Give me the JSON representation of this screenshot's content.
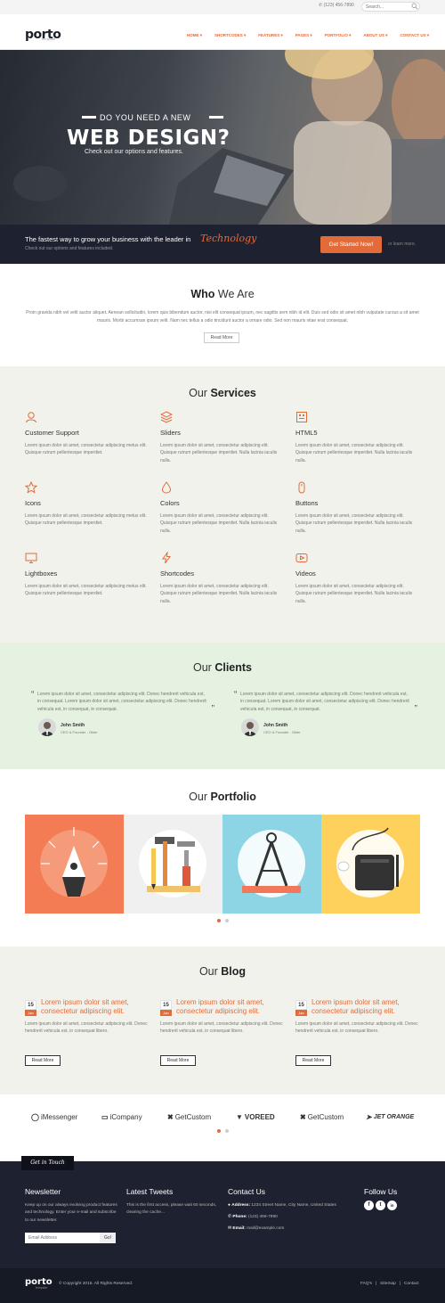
{
  "topbar": {
    "phone": "(123) 456-7890",
    "search_placeholder": "Search..."
  },
  "brand": {
    "name": "porto",
    "sub": "template"
  },
  "nav": {
    "items": [
      "HOME ▾",
      "SHORTCODES ▾",
      "FEATURES ▾",
      "PAGES ▾",
      "PORTFOLIO ▾",
      "ABOUT US ▾",
      "CONTACT US ▾"
    ]
  },
  "hero": {
    "kicker": "DO YOU NEED A NEW",
    "title": "WEB DESIGN?",
    "subtitle": "Check out our options and features."
  },
  "cta": {
    "text": "The fastest way to grow your business with the leader in",
    "highlight": "Technology",
    "sub": "Check out our options and features included.",
    "button": "Get Started Now!",
    "more": "or learn more."
  },
  "who": {
    "title_light": "Who",
    "title_rest": " We Are",
    "text": "Proin gravida nibh vel velit auctor aliquet. Aenean sollicitudin, lorem quis bibendum auctor, nisi elit consequat ipsum, nec sagittis sem nibh id elit. Duis sed odio sit amet nibh vulputate cursus a sit amet mauris. Morbi accumsan ipsum velit. Nam nec tellus a odio tincidunt auctor a ornare odio. Sed non mauris vitae erat consequat.",
    "button": "Read More"
  },
  "services": {
    "title_light": "Our ",
    "title_bold": "Services",
    "items": [
      {
        "icon": "user-icon",
        "title": "Customer Support",
        "desc": "Lorem ipsum dolor sit amet, consectetur adipiscing metus elit. Quisque rutrum pellentesque imperdiet."
      },
      {
        "icon": "layers-icon",
        "title": "Sliders",
        "desc": "Lorem ipsum dolor sit amet, consectetur adipiscing elit. Quisque rutrum pellentesque imperdiet. Nulla lacinia iaculis nulla."
      },
      {
        "icon": "html5-icon",
        "title": "HTML5",
        "desc": "Lorem ipsum dolor sit amet, consectetur adipiscing elit. Quisque rutrum pellentesque imperdiet. Nulla lacinia iaculis nulla."
      },
      {
        "icon": "star-icon",
        "title": "Icons",
        "desc": "Lorem ipsum dolor sit amet, consectetur adipiscing metus elit. Quisque rutrum pellentesque imperdiet."
      },
      {
        "icon": "drop-icon",
        "title": "Colors",
        "desc": "Lorem ipsum dolor sit amet, consectetur adipiscing elit. Quisque rutrum pellentesque imperdiet. Nulla lacinia iaculis nulla."
      },
      {
        "icon": "mouse-icon",
        "title": "Buttons",
        "desc": "Lorem ipsum dolor sit amet, consectetur adipiscing elit. Quisque rutrum pellentesque imperdiet. Nulla lacinia iaculis nulla."
      },
      {
        "icon": "monitor-icon",
        "title": "Lightboxes",
        "desc": "Lorem ipsum dolor sit amet, consectetur adipiscing metus elit. Quisque rutrum pellentesque imperdiet."
      },
      {
        "icon": "bolt-icon",
        "title": "Shortcodes",
        "desc": "Lorem ipsum dolor sit amet, consectetur adipiscing elit. Quisque rutrum pellentesque imperdiet. Nulla lacinia iaculis nulla."
      },
      {
        "icon": "play-icon",
        "title": "Videos",
        "desc": "Lorem ipsum dolor sit amet, consectetur adipiscing elit. Quisque rutrum pellentesque imperdiet. Nulla lacinia iaculis nulla."
      }
    ]
  },
  "clients": {
    "title_light": "Our ",
    "title_bold": "Clients",
    "testimonials": [
      {
        "quote": "Lorem ipsum dolor sit amet, consectetur adipiscing elit. Donec hendrerit vehicula est, in consequat. Lorem ipsum dolor sit amet, consectetur adipiscing elit. Donec hendrerit vehicula est, in consequat, in consequat.",
        "author": "John Smith",
        "role": "CEO & Founder - Okler"
      },
      {
        "quote": "Lorem ipsum dolor sit amet, consectetur adipiscing elit. Donec hendrerit vehicula est, in consequat. Lorem ipsum dolor sit amet, consectetur adipiscing elit. Donec hendrerit vehicula est, in consequat, in consequat.",
        "author": "John Smith",
        "role": "CEO & Founder - Okler"
      }
    ]
  },
  "portfolio": {
    "title_light": "Our ",
    "title_bold": "Portfolio",
    "colors": [
      "#f47c54",
      "#f0f0f0",
      "#8dd4e4",
      "#fdd15c"
    ]
  },
  "blog": {
    "title_light": "Our ",
    "title_bold": "Blog",
    "posts": [
      {
        "day": "15",
        "month": "Jan",
        "title": "Lorem ipsum dolor sit amet, consectetur adipiscing elit.",
        "desc": "Lorem ipsum dolor sit amet, consectetur adipiscing elit. Donec hendrerit vehicula est, in consequat libero.",
        "button": "Read More"
      },
      {
        "day": "15",
        "month": "Jan",
        "title": "Lorem ipsum dolor sit amet, consectetur adipiscing elit.",
        "desc": "Lorem ipsum dolor sit amet, consectetur adipiscing elit. Donec hendrerit vehicula est, in consequat libero.",
        "button": "Read More"
      },
      {
        "day": "15",
        "month": "Jan",
        "title": "Lorem ipsum dolor sit amet, consectetur adipiscing elit.",
        "desc": "Lorem ipsum dolor sit amet, consectetur adipiscing elit. Donec hendrerit vehicula est, in consequat libero.",
        "button": "Read More"
      }
    ]
  },
  "client_logos": [
    "iMessenger",
    "iCompany",
    "GetCustom",
    "VOREED",
    "GetCustom",
    "JET ORANGE"
  ],
  "footer": {
    "tab": "Get in Touch",
    "newsletter": {
      "title": "Newsletter",
      "text": "Keep up on our always evolving product features and technology. Enter your e-mail and subscribe to our newsletter.",
      "placeholder": "Email Address",
      "button": "Go!"
    },
    "tweets": {
      "title": "Latest Tweets",
      "text": "This is the first access, please wait 60 seconds, clearing the cache..."
    },
    "contact": {
      "title": "Contact Us",
      "address_label": "Address:",
      "address": "1234 Street Name, City Name, United States",
      "phone_label": "Phone:",
      "phone": "(123) 456-7890",
      "email_label": "Email:",
      "email": "mail@example.com"
    },
    "follow": {
      "title": "Follow Us",
      "icons": [
        "f",
        "t",
        "in"
      ]
    },
    "copyright": "© Copyright 2015. All Rights Reserved.",
    "links": [
      "FAQ's",
      "|",
      "Sitemap",
      "|",
      "Contact"
    ]
  },
  "colors": {
    "accent": "#e36b3a",
    "dark": "#1e2230"
  }
}
